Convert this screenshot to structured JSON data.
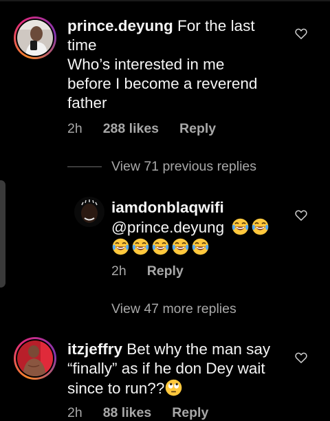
{
  "comments": [
    {
      "username": "prince.deyung",
      "text_line1": " For the last",
      "text_line2": "time",
      "text_line3": "Who’s interested in me",
      "text_line4": "before I become a reverend",
      "text_line5": "father",
      "time": "2h",
      "likes": "288 likes",
      "reply": "Reply"
    },
    {
      "username": "itzjeffry",
      "text_line1": " Bet why the man say",
      "text_line2": "“finally” as if he don Dey wait",
      "text_line3": "since to run??",
      "time": "2h",
      "likes": "88 likes",
      "reply": "Reply"
    }
  ],
  "view_previous": "View 71 previous replies",
  "reply": {
    "username": "iamdonblaqwifi",
    "mention": "@prince.deyung",
    "time": "2h",
    "reply": "Reply"
  },
  "view_more": "View 47 more replies",
  "icons": {
    "like": "heart-outline-icon",
    "emoji_laugh": "face-with-tears-of-joy-emoji",
    "emoji_roll": "face-with-rolling-eyes-emoji"
  },
  "colors": {
    "background": "#000000",
    "text": "#f5f5f5",
    "secondary": "#a8a8a8",
    "ring_start": "#f58529",
    "ring_end": "#8134af"
  }
}
